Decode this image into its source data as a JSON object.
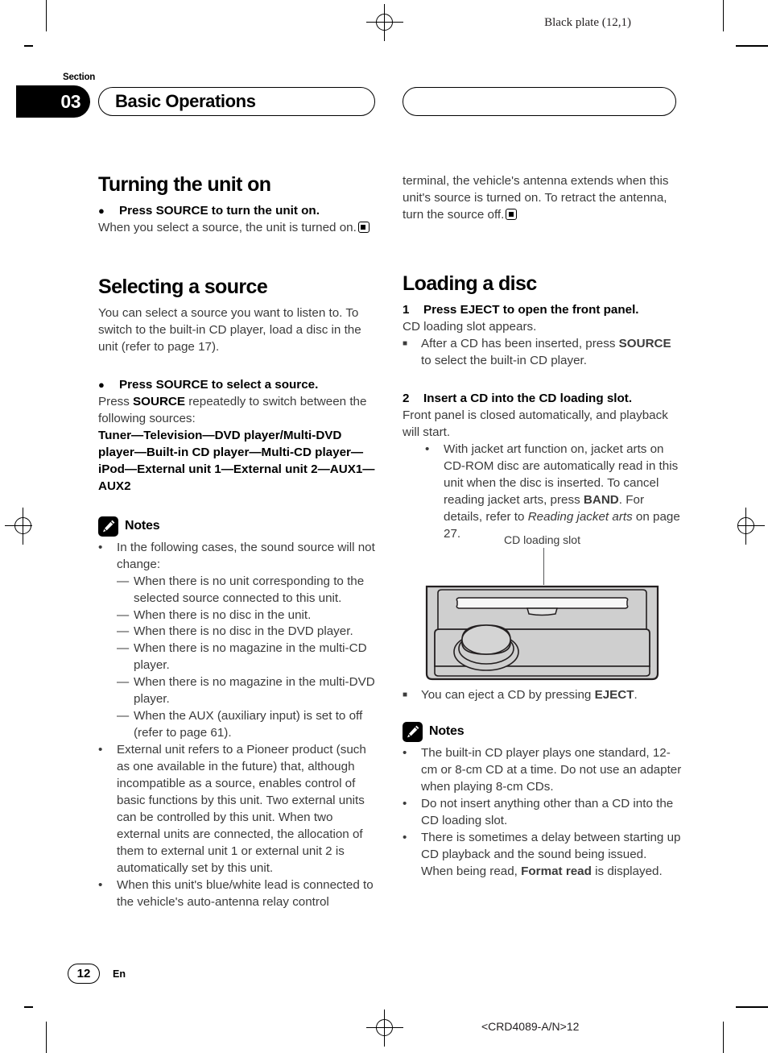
{
  "page": {
    "black_plate": "Black plate (12,1)",
    "section_label": "Section",
    "section_number": "03",
    "section_title": "Basic Operations",
    "section_title_right": "",
    "page_number": "12",
    "language": "En",
    "colophon": "<CRD4089-A/N>12"
  },
  "left_column": {
    "heading1": "Turning the unit on",
    "cmd1": "Press SOURCE to turn the unit on.",
    "cmd1_body": "When you select a source, the unit is turned on.",
    "heading2": "Selecting a source",
    "intro": "You can select a source you want to listen to. To switch to the built-in CD player, load a disc in the unit (refer to page 17).",
    "cmd2": "Press SOURCE to select a source.",
    "cmd2_body_pre": "Press ",
    "cmd2_body_bold": "SOURCE",
    "cmd2_body_post": " repeatedly to switch between the following sources:",
    "source_chain": "Tuner—Television—DVD player/Multi-DVD player—Built-in CD player—Multi-CD player—iPod—External unit 1—External unit 2—AUX1—AUX2",
    "notes_title": "Notes",
    "note1_lead": "In the following cases, the sound source will not change:",
    "note1_subitems": [
      "When there is no unit corresponding to the selected source connected to this unit.",
      "When there is no disc in the unit.",
      "When there is no disc in the DVD player.",
      "When there is no magazine in the multi-CD player.",
      "When there is no magazine in the multi-DVD player.",
      "When the AUX (auxiliary input) is set to off (refer to page 61)."
    ],
    "note2": "External unit refers to a Pioneer product (such as one available in the future) that, although incompatible as a source, enables control of basic functions by this unit. Two external units can be controlled by this unit. When two external units are connected, the allocation of them to external unit 1 or external unit 2 is automatically set by this unit.",
    "note3": "When this unit's blue/white lead is connected to the vehicle's auto-antenna relay control"
  },
  "right_column": {
    "continued": "terminal, the vehicle's antenna extends when this unit's source is turned on. To retract the antenna, turn the source off.",
    "heading1": "Loading a disc",
    "step1_num": "1",
    "step1": "Press EJECT to open the front panel.",
    "step1_body": "CD loading slot appears.",
    "step1_sub_pre": "After a CD has been inserted, press ",
    "step1_sub_bold": "SOURCE",
    "step1_sub_post": " to select the built-in CD player.",
    "step2_num": "2",
    "step2": "Insert a CD into the CD loading slot.",
    "step2_body": "Front panel is closed automatically, and playback will start.",
    "step2_sub_pre": "With jacket art function on, jacket arts on CD-ROM disc are automatically read in this unit when the disc is inserted. To cancel reading jacket arts, press ",
    "step2_sub_bold": "BAND",
    "step2_sub_mid": ". For details, refer to ",
    "step2_sub_italic": "Reading jacket arts",
    "step2_sub_post": " on page 27.",
    "figure_caption": "CD loading slot",
    "eject_note_pre": "You can eject a CD by pressing ",
    "eject_note_bold": "EJECT",
    "eject_note_post": ".",
    "notes_title": "Notes",
    "note1": "The built-in CD player plays one standard, 12-cm or 8-cm CD at a time. Do not use an adapter when playing 8-cm CDs.",
    "note2": "Do not insert anything other than a CD into the CD loading slot.",
    "note3_pre": "There is sometimes a delay between starting up CD playback and the sound being issued. When being read, ",
    "note3_bold": "Format read",
    "note3_post": " is displayed."
  },
  "markers": {
    "bullet_dot": "●",
    "bullet_small": "•",
    "bullet_square": "■",
    "dash": "—"
  },
  "colors": {
    "ink": "#231f20",
    "body_text": "#3b3b3b",
    "accent_black": "#000000",
    "figure_fill": "#cfcfcf",
    "figure_light": "#f2f2f2",
    "figure_outline": "#231f20"
  }
}
